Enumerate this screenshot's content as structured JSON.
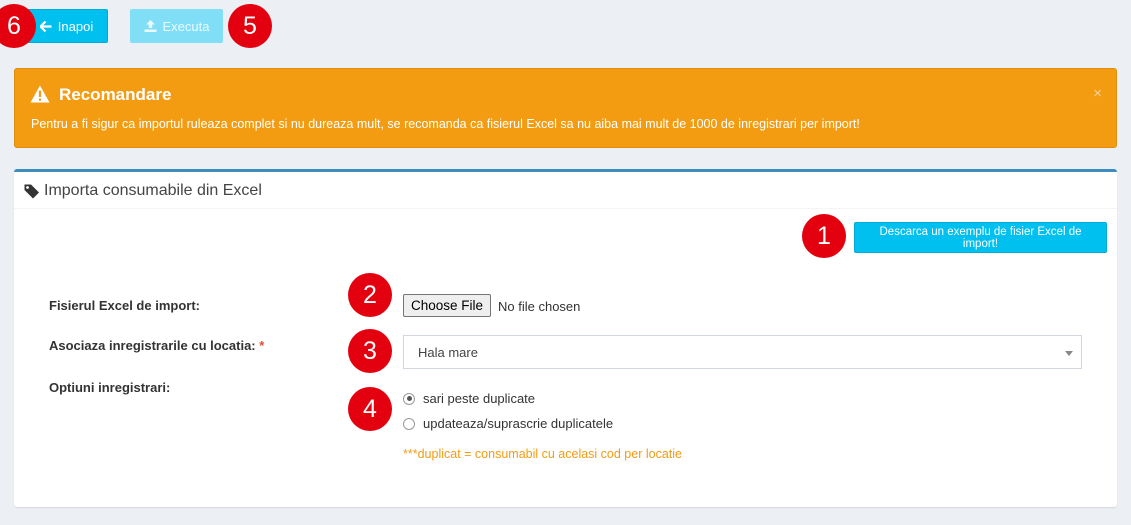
{
  "toolbar": {
    "back_label": "Inapoi",
    "execute_label": "Executa"
  },
  "markers": {
    "m1": "1",
    "m2": "2",
    "m3": "3",
    "m4": "4",
    "m5": "5",
    "m6": "6"
  },
  "alert": {
    "title": "Recomandare",
    "text": "Pentru a fi sigur ca importul ruleaza complet si nu dureaza mult, se recomanda ca fisierul Excel sa nu aiba mai mult de 1000 de inregistrari per import!",
    "close": "×"
  },
  "panel": {
    "title": "Importa consumabile din Excel",
    "download_label": "Descarca un exemplu de fisier Excel de import!",
    "file_label": "Fisierul Excel de import:",
    "file_button": "Choose File",
    "file_status": "No file chosen",
    "location_label": "Asociaza inregistrarile cu locatia:",
    "required_mark": "*",
    "location_value": "Hala mare",
    "options_label": "Optiuni inregistrari:",
    "options": [
      {
        "label": "sari peste duplicate",
        "checked": true
      },
      {
        "label": "updateaza/suprascrie duplicatele",
        "checked": false
      }
    ],
    "note": "***duplicat = consumabil cu acelasi cod per locatie"
  },
  "colors": {
    "accent": "#00c0ef",
    "warning": "#f39c12",
    "marker": "#e3000f",
    "panel_border": "#3c8dbc"
  }
}
